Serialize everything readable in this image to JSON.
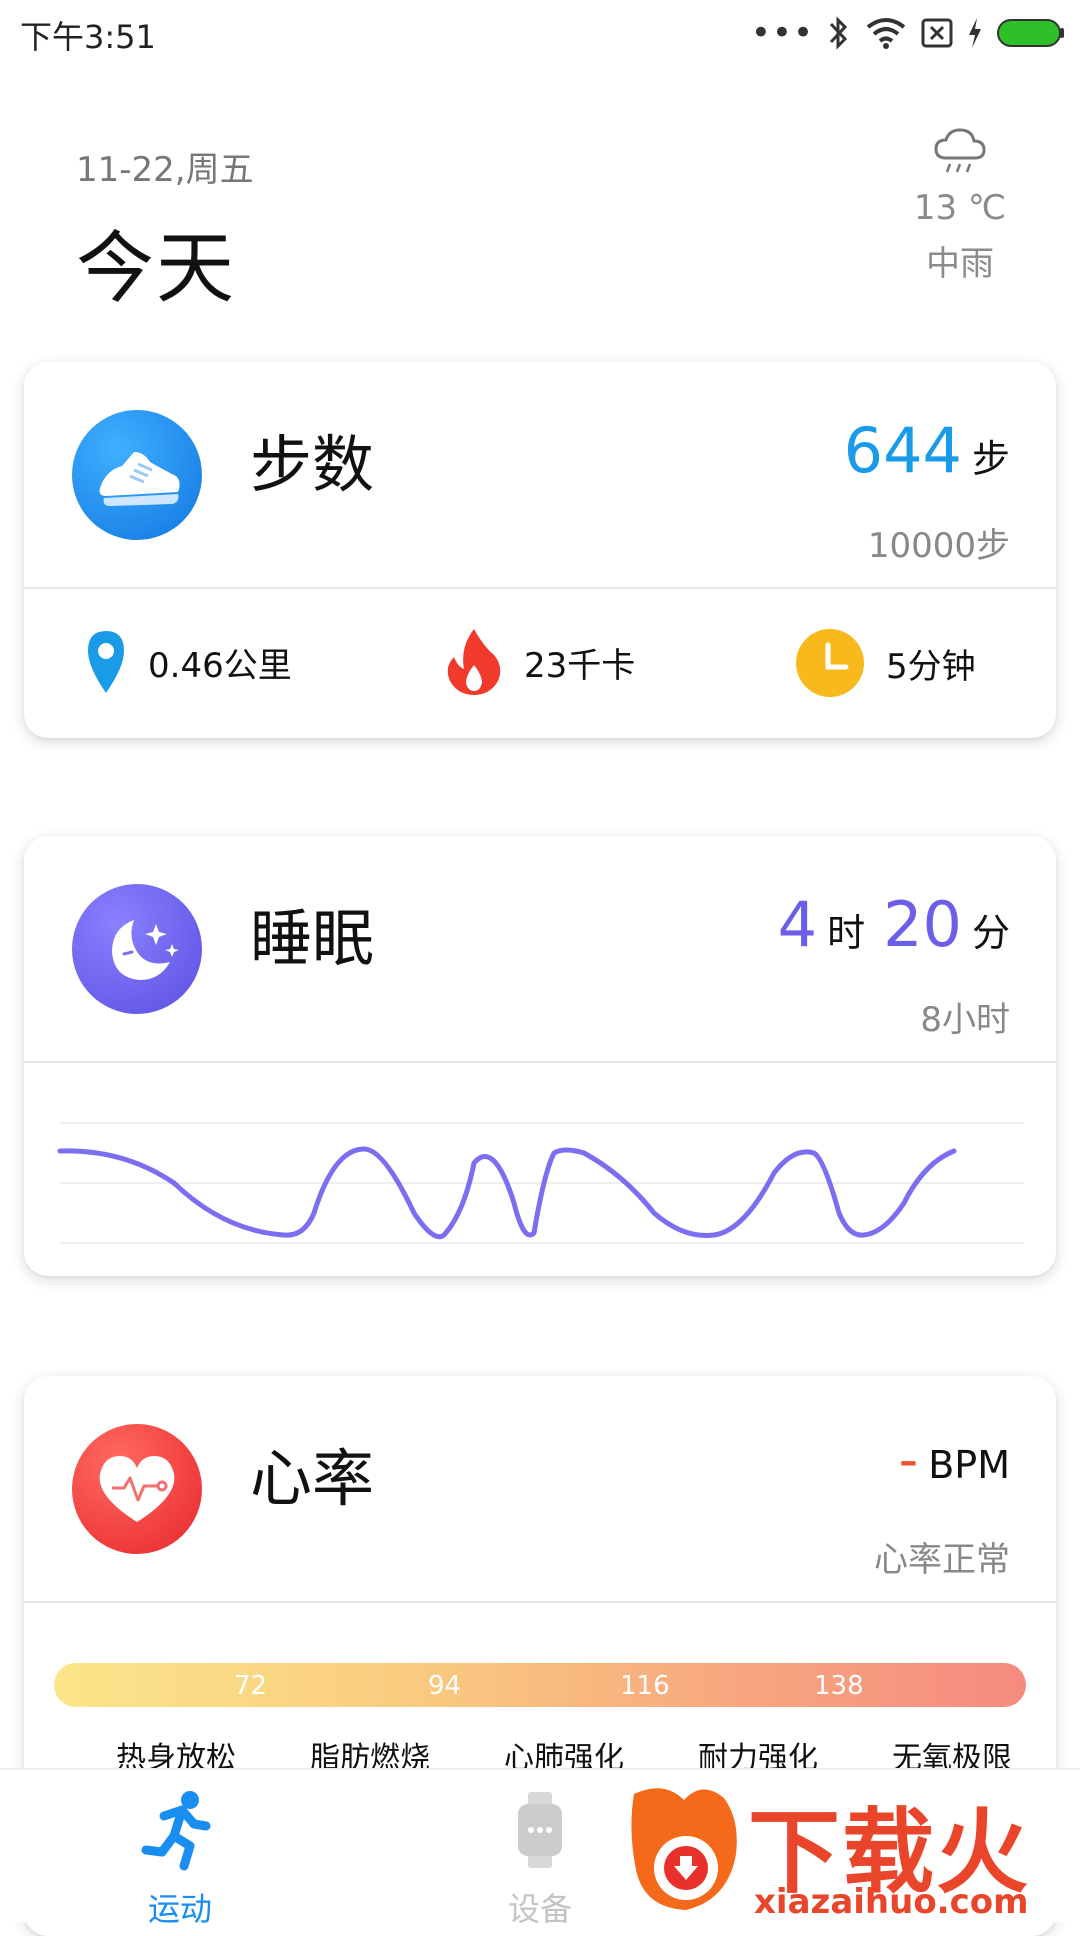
{
  "status": {
    "time": "下午3:51",
    "dots": "•••"
  },
  "header": {
    "date": "11-22,周五",
    "title": "今天",
    "weather": {
      "temp": "13 ℃",
      "desc": "中雨",
      "icon": "rain-cloud-icon"
    }
  },
  "steps": {
    "title": "步数",
    "value": "644",
    "unit": "步",
    "goal": "10000步",
    "accent": "#1a9be8",
    "stats": [
      {
        "icon": "location-pin-icon",
        "text": "0.46公里"
      },
      {
        "icon": "flame-icon",
        "text": "23千卡"
      },
      {
        "icon": "clock-icon",
        "text": "5分钟"
      }
    ]
  },
  "sleep": {
    "title": "睡眠",
    "hours": "4",
    "hours_unit": "时",
    "minutes": "20",
    "minutes_unit": "分",
    "goal": "8小时",
    "accent": "#6b5ee8"
  },
  "heart": {
    "title": "心率",
    "value": "-",
    "unit": "BPM",
    "status": "心率正常",
    "accent": "#f0502c",
    "zone_ticks": [
      "72",
      "94",
      "116",
      "138"
    ],
    "zones": [
      "热身放松",
      "脂肪燃烧",
      "心肺强化",
      "耐力强化",
      "无氧极限"
    ]
  },
  "tabs": [
    {
      "label": "运动",
      "icon": "running-person-icon",
      "active": true
    },
    {
      "label": "设备",
      "icon": "watch-icon",
      "active": false
    }
  ],
  "watermark": {
    "brand": "下载火",
    "url": "xiazaihuo.com"
  }
}
